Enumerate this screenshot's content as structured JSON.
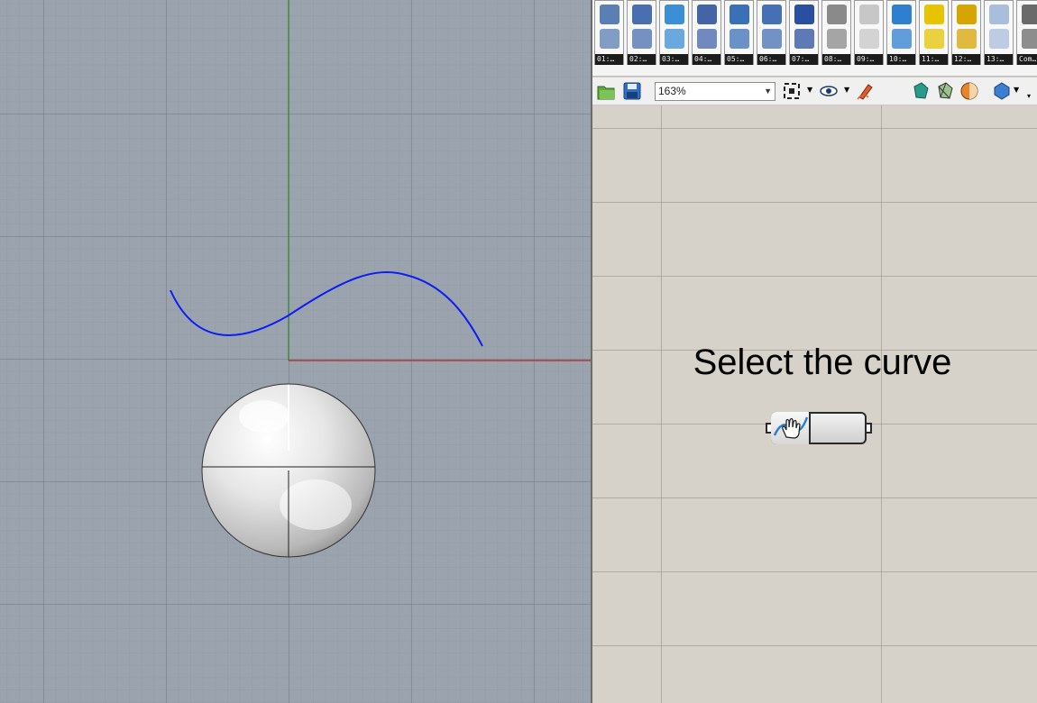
{
  "viewport": {
    "curve_color": "#0b1ef5",
    "x_axis_color": "#b22222",
    "y_axis_color": "#2e8b2e"
  },
  "grasshopper": {
    "tabs": [
      {
        "label": "01:…",
        "icon": "params-icon",
        "color": "#5a7fb5"
      },
      {
        "label": "02:…",
        "icon": "curve-points-icon",
        "color": "#4a6fb0"
      },
      {
        "label": "03:…",
        "icon": "surface-icon",
        "color": "#3b8fd6"
      },
      {
        "label": "04:…",
        "icon": "mesh-icon",
        "color": "#4464a8"
      },
      {
        "label": "05:…",
        "icon": "intersect-icon",
        "color": "#3b6fb8"
      },
      {
        "label": "06:…",
        "icon": "transform-icon",
        "color": "#4570b5"
      },
      {
        "label": "07:…",
        "icon": "text-icon",
        "color": "#2a4fa0"
      },
      {
        "label": "08:…",
        "icon": "hand-icon",
        "color": "#8a8a8a"
      },
      {
        "label": "09:…",
        "icon": "display-icon",
        "color": "#c7c7c7"
      },
      {
        "label": "10:…",
        "icon": "kangaroo-icon",
        "color": "#2e7fd0"
      },
      {
        "label": "11:…",
        "icon": "color-grid-icon",
        "color": "#e8c400"
      },
      {
        "label": "12:…",
        "icon": "layers-icon",
        "color": "#d7a500"
      },
      {
        "label": "13:…",
        "icon": "shape-icon",
        "color": "#a9bedc"
      },
      {
        "label": "Com…",
        "icon": "commands-icon",
        "color": "#6a6a6a"
      }
    ],
    "toolbar": {
      "zoom": "163%"
    },
    "canvas": {
      "group_title": "Select the curve"
    }
  }
}
